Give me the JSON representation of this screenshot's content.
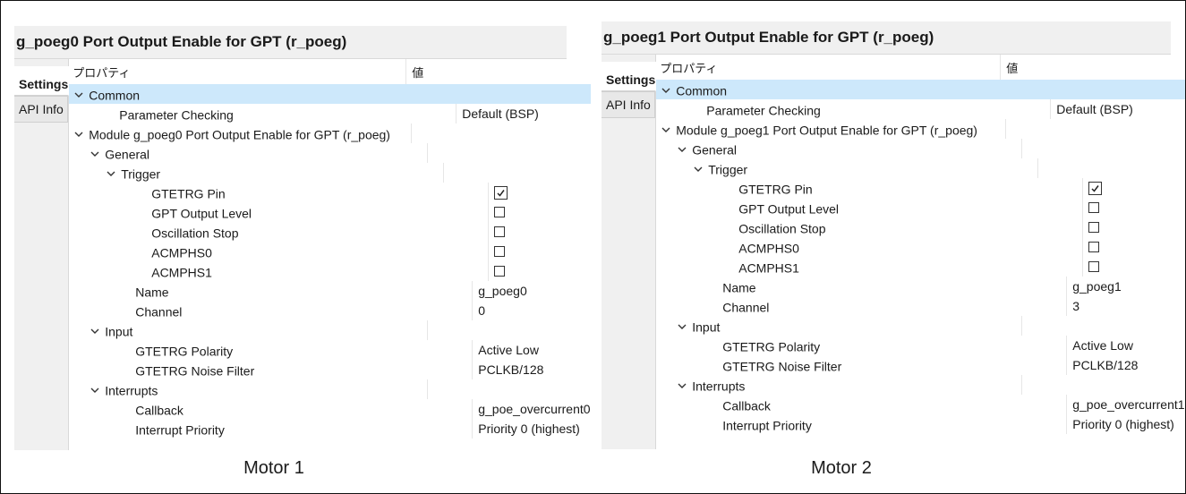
{
  "panels": [
    {
      "title": "g_poeg0 Port Output Enable for GPT (r_poeg)",
      "tabs": {
        "settings": "Settings",
        "api_info": "API Info"
      },
      "columns": {
        "property": "プロパティ",
        "value": "値"
      },
      "rows": [
        {
          "label": "Common",
          "value": "",
          "indent": 0,
          "expander": true,
          "selected": true
        },
        {
          "label": "Parameter Checking",
          "value": "Default (BSP)",
          "indent": 2
        },
        {
          "label": "Module g_poeg0 Port Output Enable for GPT (r_poeg)",
          "value": "",
          "indent": 0,
          "expander": true
        },
        {
          "label": "General",
          "value": "",
          "indent": 1,
          "expander": true
        },
        {
          "label": "Trigger",
          "value": "",
          "indent": 2,
          "expander": true
        },
        {
          "label": "GTETRG Pin",
          "value": "",
          "indent": 4,
          "checkbox": true,
          "checked": true
        },
        {
          "label": "GPT Output Level",
          "value": "",
          "indent": 4,
          "checkbox": true,
          "checked": false
        },
        {
          "label": "Oscillation Stop",
          "value": "",
          "indent": 4,
          "checkbox": true,
          "checked": false
        },
        {
          "label": "ACMPHS0",
          "value": "",
          "indent": 4,
          "checkbox": true,
          "checked": false
        },
        {
          "label": "ACMPHS1",
          "value": "",
          "indent": 4,
          "checkbox": true,
          "checked": false
        },
        {
          "label": "Name",
          "value": "g_poeg0",
          "indent": 3
        },
        {
          "label": "Channel",
          "value": "0",
          "indent": 3
        },
        {
          "label": "Input",
          "value": "",
          "indent": 1,
          "expander": true
        },
        {
          "label": "GTETRG Polarity",
          "value": "Active Low",
          "indent": 3
        },
        {
          "label": "GTETRG Noise Filter",
          "value": "PCLKB/128",
          "indent": 3
        },
        {
          "label": "Interrupts",
          "value": "",
          "indent": 1,
          "expander": true
        },
        {
          "label": "Callback",
          "value": "g_poe_overcurrent0",
          "indent": 3
        },
        {
          "label": "Interrupt Priority",
          "value": "Priority 0 (highest)",
          "indent": 3
        }
      ],
      "caption": "Motor 1"
    },
    {
      "title": "g_poeg1 Port Output Enable for GPT (r_poeg)",
      "tabs": {
        "settings": "Settings",
        "api_info": "API Info"
      },
      "columns": {
        "property": "プロパティ",
        "value": "値"
      },
      "rows": [
        {
          "label": "Common",
          "value": "",
          "indent": 0,
          "expander": true,
          "selected": true
        },
        {
          "label": "Parameter Checking",
          "value": "Default (BSP)",
          "indent": 2
        },
        {
          "label": "Module g_poeg1 Port Output Enable for GPT (r_poeg)",
          "value": "",
          "indent": 0,
          "expander": true
        },
        {
          "label": "General",
          "value": "",
          "indent": 1,
          "expander": true
        },
        {
          "label": "Trigger",
          "value": "",
          "indent": 2,
          "expander": true
        },
        {
          "label": "GTETRG Pin",
          "value": "",
          "indent": 4,
          "checkbox": true,
          "checked": true
        },
        {
          "label": "GPT Output Level",
          "value": "",
          "indent": 4,
          "checkbox": true,
          "checked": false
        },
        {
          "label": "Oscillation Stop",
          "value": "",
          "indent": 4,
          "checkbox": true,
          "checked": false
        },
        {
          "label": "ACMPHS0",
          "value": "",
          "indent": 4,
          "checkbox": true,
          "checked": false
        },
        {
          "label": "ACMPHS1",
          "value": "",
          "indent": 4,
          "checkbox": true,
          "checked": false
        },
        {
          "label": "Name",
          "value": "g_poeg1",
          "indent": 3
        },
        {
          "label": "Channel",
          "value": "3",
          "indent": 3
        },
        {
          "label": "Input",
          "value": "",
          "indent": 1,
          "expander": true
        },
        {
          "label": "GTETRG Polarity",
          "value": "Active Low",
          "indent": 3
        },
        {
          "label": "GTETRG Noise Filter",
          "value": "PCLKB/128",
          "indent": 3
        },
        {
          "label": "Interrupts",
          "value": "",
          "indent": 1,
          "expander": true
        },
        {
          "label": "Callback",
          "value": "g_poe_overcurrent1",
          "indent": 3
        },
        {
          "label": "Interrupt Priority",
          "value": "Priority 0 (highest)",
          "indent": 3
        }
      ],
      "caption": "Motor 2"
    }
  ],
  "colors": {
    "selected_row": "#cde8fb",
    "tab_bg": "#f0f0f0",
    "title_bg": "#f0f0f0"
  },
  "icons": {
    "expander": "chevron-down-icon",
    "checkbox": "checkbox-icon"
  }
}
